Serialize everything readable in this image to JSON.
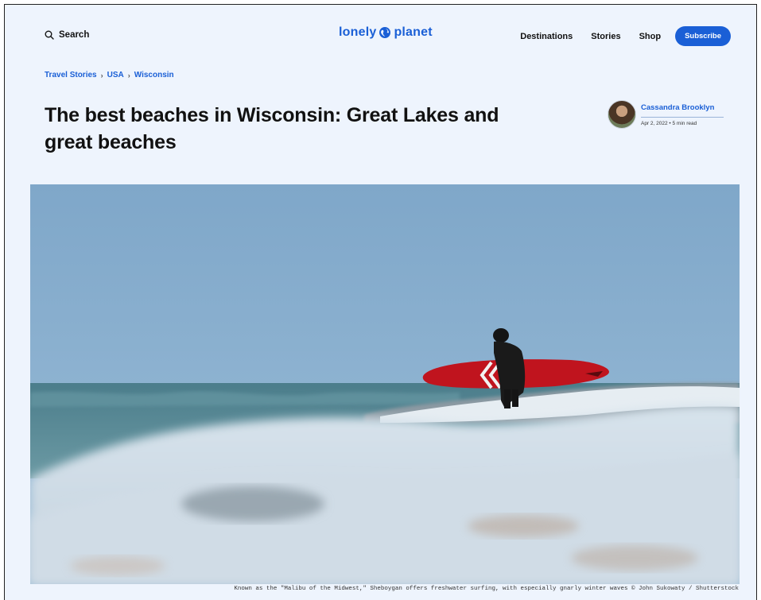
{
  "header": {
    "search_label": "Search",
    "logo_text_left": "lonely",
    "logo_text_right": "planet",
    "nav": [
      {
        "label": "Destinations"
      },
      {
        "label": "Stories"
      },
      {
        "label": "Shop"
      }
    ],
    "subscribe_label": "Subscribe"
  },
  "breadcrumb": {
    "items": [
      "Travel Stories",
      "USA",
      "Wisconsin"
    ],
    "separator": "›"
  },
  "article": {
    "title": "The best beaches in Wisconsin: Great Lakes and great beaches",
    "author": "Cassandra Brooklyn",
    "meta": "Apr 2, 2022 • 5 min read"
  },
  "hero": {
    "caption": "Known as the \"Malibu of the Midwest,\" Sheboygan offers freshwater surfing, with especially gnarly winter waves © John Sukowaty / Shutterstock"
  },
  "colors": {
    "brand_blue": "#1a5fd6",
    "page_bg": "#eef4fd",
    "surfboard_red": "#c0141e"
  }
}
